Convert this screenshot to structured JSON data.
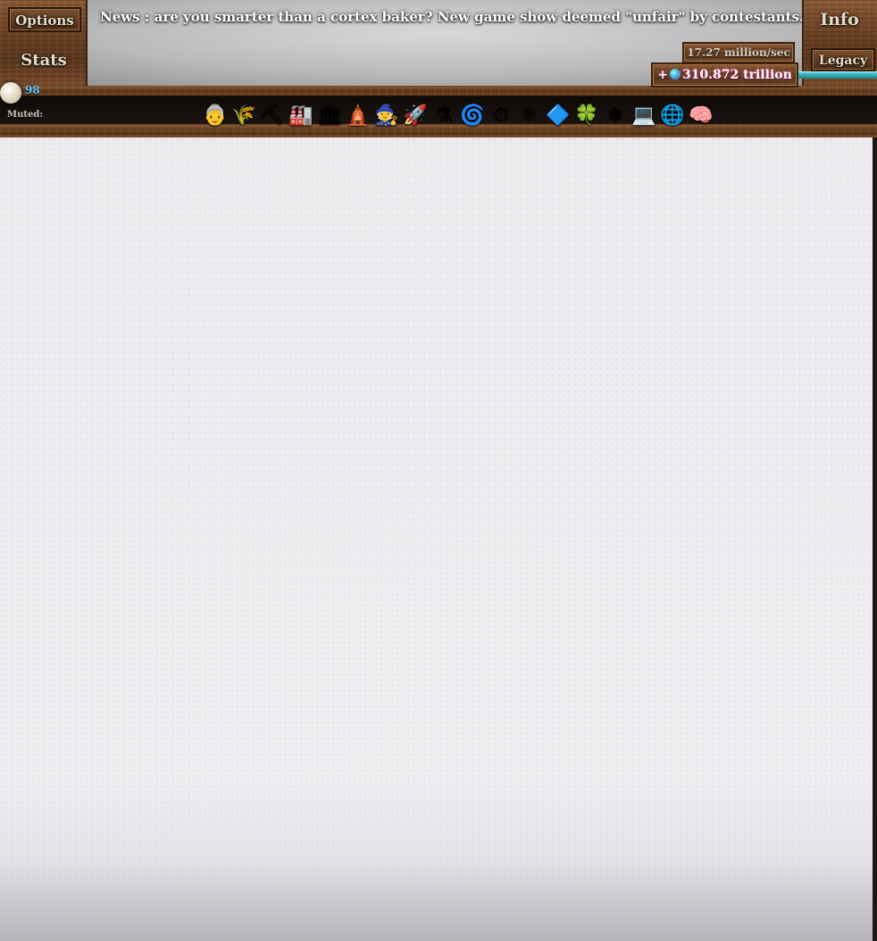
{
  "menu": {
    "options_label": "Options",
    "stats_label": "Stats",
    "info_label": "Info",
    "legacy_label": "Legacy"
  },
  "news": "News : are you smarter than a cortex baker? New game show deemed \"unfair\" by contestants.",
  "cookies": {
    "per_second": "17.27 million/sec",
    "bank_prefix": "+",
    "bank_amount": "310.872 trillion"
  },
  "sugar_lumps": {
    "count": "98"
  },
  "muted_label": "Muted:",
  "buildings": [
    {
      "name": "Grandma",
      "icon": "grandma-icon",
      "glyph": "👵"
    },
    {
      "name": "Farm",
      "icon": "farm-icon",
      "glyph": "🌾"
    },
    {
      "name": "Mine",
      "icon": "mine-icon",
      "glyph": "⛏"
    },
    {
      "name": "Factory",
      "icon": "factory-icon",
      "glyph": "🏭"
    },
    {
      "name": "Bank",
      "icon": "bank-icon",
      "glyph": "🏛"
    },
    {
      "name": "Temple",
      "icon": "temple-icon",
      "glyph": "🛕"
    },
    {
      "name": "Wizard tower",
      "icon": "wizard-tower-icon",
      "glyph": "🧙"
    },
    {
      "name": "Shipment",
      "icon": "shipment-icon",
      "glyph": "🚀"
    },
    {
      "name": "Alchemy lab",
      "icon": "alchemy-lab-icon",
      "glyph": "⚗"
    },
    {
      "name": "Portal",
      "icon": "portal-icon",
      "glyph": "🌀"
    },
    {
      "name": "Time machine",
      "icon": "time-machine-icon",
      "glyph": "⏱"
    },
    {
      "name": "Antimatter condenser",
      "icon": "antimatter-condenser-icon",
      "glyph": "⚛"
    },
    {
      "name": "Prism",
      "icon": "prism-icon",
      "glyph": "🔷"
    },
    {
      "name": "Chancemaker",
      "icon": "chancemaker-icon",
      "glyph": "🍀"
    },
    {
      "name": "Fractal engine",
      "icon": "fractal-engine-icon",
      "glyph": "❄"
    },
    {
      "name": "Javascript console",
      "icon": "javascript-console-icon",
      "glyph": "💻"
    },
    {
      "name": "Idleverse",
      "icon": "idleverse-icon",
      "glyph": "🌐"
    },
    {
      "name": "Cortex baker",
      "icon": "cortex-baker-icon",
      "glyph": "🧠"
    }
  ],
  "colors": {
    "wood": "#6e4425",
    "lump_count": "#5fc8ff",
    "legacy_meter": "#4fd0d8",
    "playfield": "#eeecef"
  }
}
